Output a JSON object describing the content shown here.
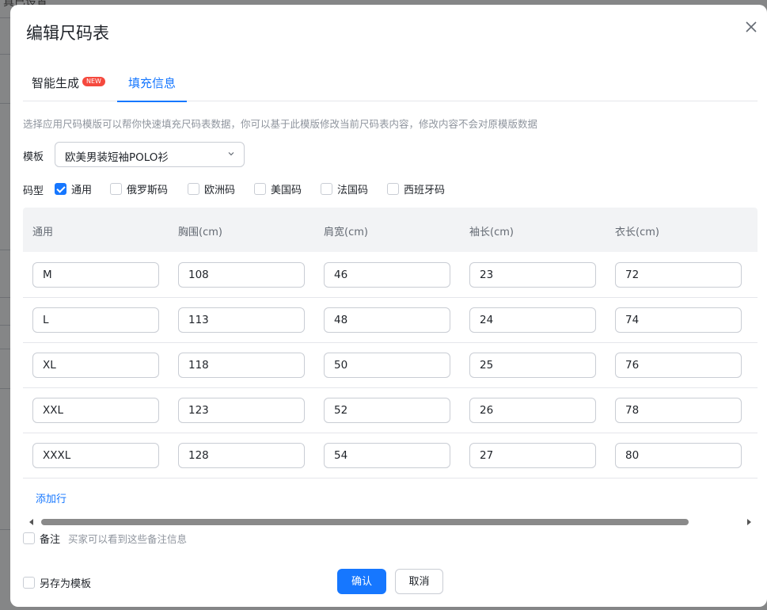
{
  "background": {
    "top_text": "真已设置"
  },
  "modal": {
    "title": "编辑尺码表",
    "tabs": [
      {
        "label": "智能生成",
        "badge": "NEW"
      },
      {
        "label": "填充信息",
        "active": true
      }
    ],
    "hint": "选择应用尺码模版可以帮你快速填充尺码表数据，你可以基于此模版修改当前尺码表内容，修改内容不会对原模版数据",
    "template": {
      "label": "模板",
      "value": "欧美男装短袖POLO衫"
    },
    "size_types": {
      "label": "码型",
      "options": [
        {
          "label": "通用",
          "checked": true
        },
        {
          "label": "俄罗斯码",
          "checked": false
        },
        {
          "label": "欧洲码",
          "checked": false
        },
        {
          "label": "美国码",
          "checked": false
        },
        {
          "label": "法国码",
          "checked": false
        },
        {
          "label": "西班牙码",
          "checked": false
        }
      ]
    },
    "table": {
      "headers": [
        "通用",
        "胸围(cm)",
        "肩宽(cm)",
        "袖长(cm)",
        "衣长(cm)"
      ],
      "rows": [
        [
          "M",
          "108",
          "46",
          "23",
          "72"
        ],
        [
          "L",
          "113",
          "48",
          "24",
          "74"
        ],
        [
          "XL",
          "118",
          "50",
          "25",
          "76"
        ],
        [
          "XXL",
          "123",
          "52",
          "26",
          "78"
        ],
        [
          "XXXL",
          "128",
          "54",
          "27",
          "80"
        ]
      ]
    },
    "add_row": "添加行",
    "remark": {
      "label": "备注",
      "sub": "买家可以看到这些备注信息",
      "checked": false
    },
    "save_as_template": {
      "label": "另存为模板",
      "checked": false
    },
    "buttons": {
      "confirm": "确认",
      "cancel": "取消"
    }
  },
  "colors": {
    "primary": "#1677ff",
    "badge": "#f5493e",
    "header_bg": "#f2f3f5"
  }
}
